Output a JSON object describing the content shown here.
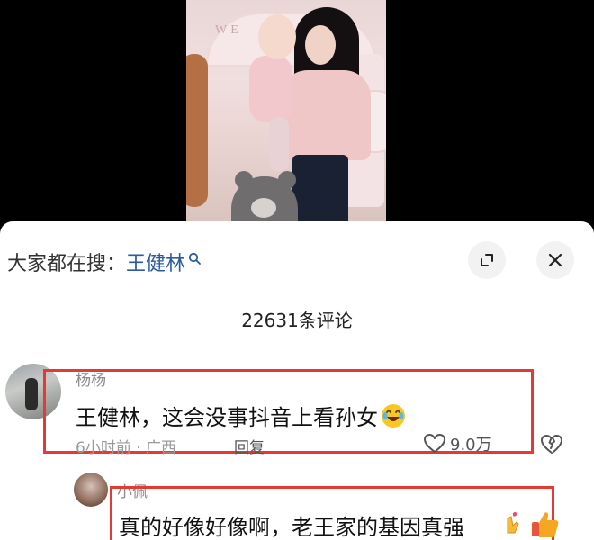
{
  "video": {
    "sign_text": "WE"
  },
  "search": {
    "prefix": "大家都在搜：",
    "term": "王健林"
  },
  "comments_header": {
    "count_label": "22631条评论"
  },
  "comments": [
    {
      "username": "杨杨",
      "text": "王健林，这会没事抖音上看孙女",
      "meta": "6小时前 · 广西",
      "reply_label": "回复",
      "like_count": "9.0万"
    },
    {
      "username": "小佩",
      "text": "真的好像好像啊，老王家的基因真强"
    }
  ],
  "colors": {
    "highlight_border": "#e53935",
    "search_term": "#2c5a9e"
  },
  "icons": {
    "expand": "expand-icon",
    "close": "close-icon",
    "search": "search-icon",
    "like": "heart-outline-icon",
    "dislike": "broken-heart-icon"
  }
}
